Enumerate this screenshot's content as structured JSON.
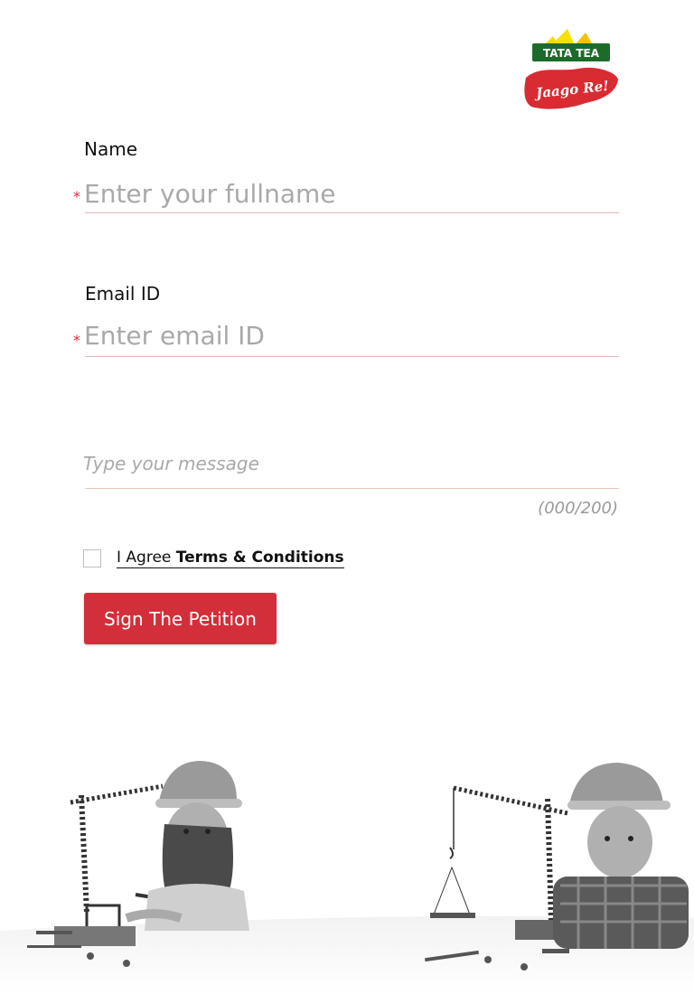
{
  "brand": {
    "top": "TATA TEA",
    "bottom": "Jaago Re!"
  },
  "form": {
    "name": {
      "label": "Name",
      "required_mark": "*",
      "placeholder": "Enter your fullname",
      "value": ""
    },
    "email": {
      "label": "Email ID",
      "required_mark": "*",
      "placeholder": "Enter email ID",
      "value": ""
    },
    "message": {
      "placeholder": "Type your message",
      "value": "",
      "counter": "(000/200)"
    },
    "agree": {
      "prefix": "I Agree",
      "link": "Terms & Conditions",
      "checked": false
    },
    "submit_label": "Sign The Petition"
  },
  "colors": {
    "accent": "#d32f3a",
    "underline": "#e6b4b7"
  },
  "icons": [
    "tata-tea-logo",
    "jaago-re-logo",
    "checkbox-icon"
  ]
}
